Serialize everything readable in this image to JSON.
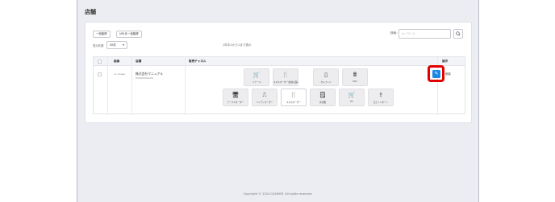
{
  "page": {
    "title": "店舗"
  },
  "toolbar": {
    "bulk_get_label": "一括取得",
    "url_bulk_get_label": "URLを一括取得",
    "per_page_label": "表示件数",
    "per_page_value": "50件",
    "summary": "1件中1から1まで表示",
    "search_label": "検索：",
    "search_placeholder": "キーワード"
  },
  "table": {
    "headers": {
      "image": "画像",
      "store": "店舗",
      "channels": "販売チャネル",
      "actions": "操作"
    },
    "row": {
      "image_text": "no image",
      "store_name": "株式会社マニュアル",
      "delete_label": "削除"
    }
  },
  "channels": [
    {
      "label": "リテール",
      "icon": "basket-icon",
      "glyph": "🛒",
      "selected": false
    },
    {
      "label": "スマホオーダー(飲食店舗)",
      "icon": "utensils-icon",
      "glyph": "🍴",
      "selected": false
    },
    {
      "label": "セルフレジ",
      "icon": "tablet-icon",
      "glyph": "▯",
      "selected": false
    },
    {
      "label": "POS",
      "icon": "pos-icon",
      "glyph": "🖩",
      "selected": false
    },
    {
      "label": "テーブルオーダー",
      "icon": "monitor-icon",
      "glyph": "🖥",
      "selected": false
    },
    {
      "label": "ハンディオーダー",
      "icon": "handy-icon",
      "glyph": "⎍",
      "selected": false
    },
    {
      "label": "スマホオーダー",
      "icon": "utensils-icon",
      "glyph": "🍴",
      "selected": true
    },
    {
      "label": "券売機",
      "icon": "ticket-icon",
      "glyph": "🗒",
      "selected": false
    },
    {
      "label": "EC",
      "icon": "cart-icon",
      "glyph": "🛒",
      "selected": false
    },
    {
      "label": "売上インポート",
      "icon": "import-icon",
      "glyph": "⇪",
      "selected": false
    }
  ],
  "footer": {
    "copyright": "Copyright © 2024 CASHIER. All rights reserved."
  },
  "colors": {
    "accent": "#1e88e5",
    "highlight": "#e00000",
    "background": "#ecedf2"
  }
}
